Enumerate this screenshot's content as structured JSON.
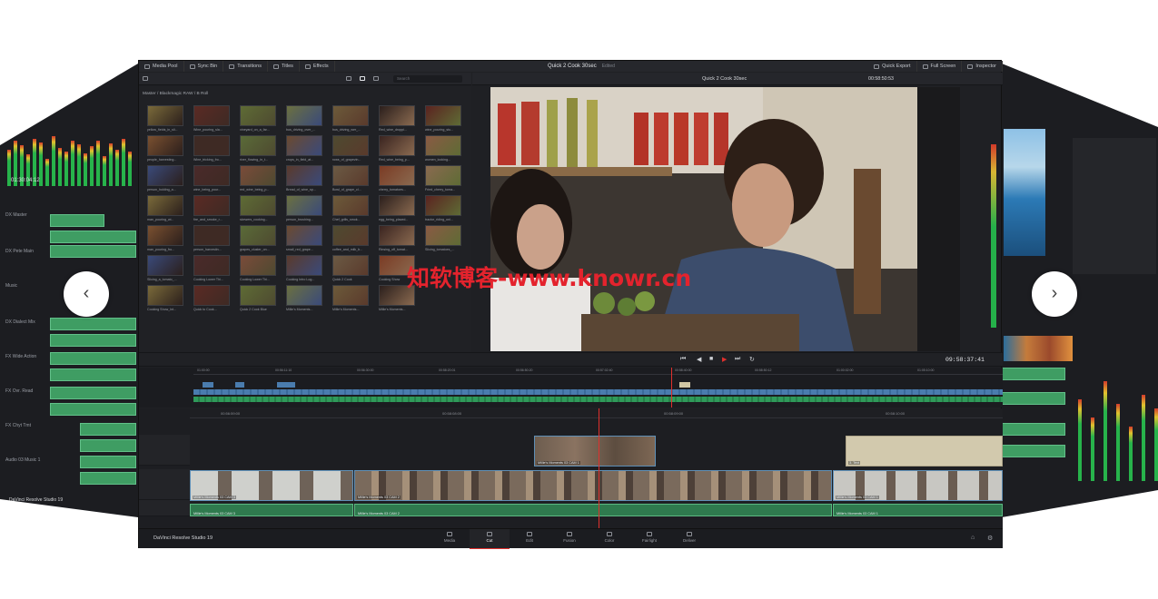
{
  "topbar": {
    "media_pool": "Media Pool",
    "sync_bin": "Sync Bin",
    "transitions": "Transitions",
    "titles": "Titles",
    "effects": "Effects",
    "project_title": "Quick 2 Cook 30sec",
    "edited": "Edited",
    "quick_export": "Quick Export",
    "full_screen": "Full Screen",
    "inspector": "Inspector"
  },
  "pool": {
    "search_placeholder": "Search",
    "breadcrumb": "Master / Blackmagic RAW / B Roll",
    "clips": [
      "yellow_fields_in_sli...",
      "Wine_pouring_sla...",
      "vineyard_on_a_far...",
      "bus_driving_over_...",
      "bus_driving_wer_...",
      "Red_wine_droppi...",
      "wine_pouring_stu...",
      "people_harvesting...",
      "Wine_tricking_fro...",
      "river_flowing_in_t...",
      "crops_in_field_at...",
      "rows_of_grapevin...",
      "Red_wine_being_p...",
      "women_looking...",
      "person_holding_a...",
      "wine_being_pour...",
      "red_wine_being_p...",
      "Bread_of_wine_sp...",
      "Bowl_of_grape_cl...",
      "cherry_tomatoes...",
      "Fried_cherry_toma...",
      "man_pouring_wi...",
      "fire_and_smoke_r...",
      "skewers_cooking...",
      "person_brushing...",
      "Chef_grills_smok...",
      "egg_being_placed...",
      "tractor_riding_onl...",
      "man_pouring_fro...",
      "person_harvestin...",
      "grapes_cluster_on...",
      "small_red_grape...",
      "coffee_and_milk_b...",
      "Rinsing_off_tomat...",
      "Slicing_tomatoes_...",
      "Slicing_a_tomato_...",
      "Cooking Lower Thi...",
      "Cooking Lower Thi...",
      "Cooking Intro Log...",
      "Quick 2 Cook",
      "Cooking Show",
      "",
      "Cooking Show_Int...",
      "Quick to Cook...",
      "Quick 2 Cook Blue",
      "Millie's Moments...",
      "Millie's Moments...",
      "Millie's Moments...",
      ""
    ]
  },
  "viewer": {
    "timeline_name": "Quick 2 Cook 30sec",
    "timecode_small": "00:58:50:53",
    "timecode_big": "09:58:37:41"
  },
  "timeline": {
    "ruler_small": [
      "01:00:00",
      "00:56:11:10",
      "00:56:30:00",
      "00:58:20:01",
      "00:56:50:20",
      "00:57:02:40",
      "00:58:40:00",
      "00:58:50:12",
      "01:00:02:00",
      "01:05:10:00"
    ],
    "ruler_big": [
      "00:56:59:00",
      "00:58:08:00",
      "00:58:09:00",
      "00:58:10:00"
    ],
    "clip_v2": "Millie's Moments 03 CAM 1",
    "clip_title": "3. Text",
    "clip_v1a": "Millie's Moments 03 CAM 3",
    "clip_v1b": "Millie's Moments 03 CAM 2",
    "clip_v1c": "Millie's Moments 03 CAM 1",
    "audio_a": "Millie's Moments 03 CAM 3",
    "audio_b": "Millie's Moments 03 CAM 2",
    "audio_c": "Millie's Moments 03 CAM 1"
  },
  "pagebar": {
    "brand": "DaVinci Resolve Studio 19",
    "pages": [
      "Media",
      "Cut",
      "Edit",
      "Fusion",
      "Color",
      "Fairlight",
      "Deliver"
    ],
    "active_page": "Cut"
  },
  "left_panel": {
    "timecode": "01:30:04:12",
    "tracks": [
      "DX Master",
      "DX Pete Main",
      "Music",
      "DX Dialect Mix",
      "FX Wide Action",
      "FX Ovr. Read",
      "FX Chyt Tmt",
      "Audio 03 Music 1"
    ],
    "brand": "DaVinci Resolve Studio 19"
  },
  "watermark": "知软博客-www.knowr.cn",
  "nav": {
    "prev": "‹",
    "next": "›"
  }
}
